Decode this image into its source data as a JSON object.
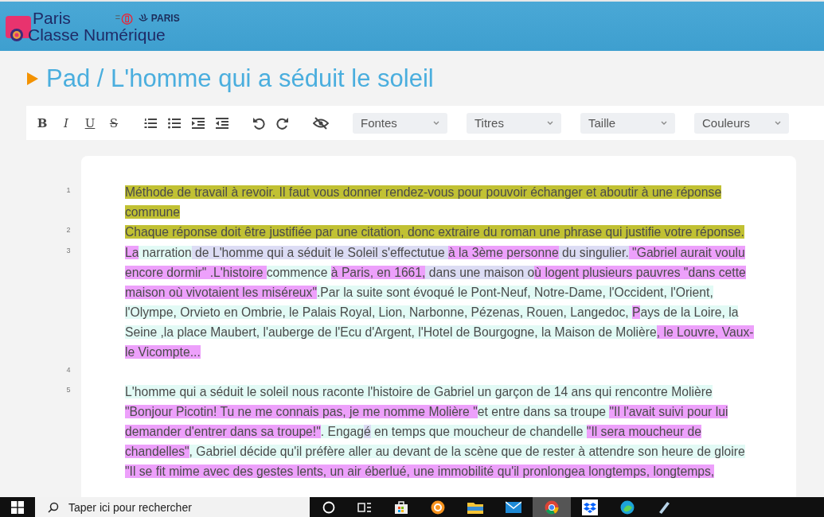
{
  "header": {
    "logo_line1": "Paris",
    "logo_line2": "Classe Numérique",
    "partner": "PARIS"
  },
  "title": "Pad / L'homme qui a séduit le soleil",
  "toolbar": {
    "format_buttons": [
      {
        "label": "B",
        "kind": "bold"
      },
      {
        "label": "I",
        "kind": "italic"
      },
      {
        "label": "U",
        "kind": "underline"
      },
      {
        "label": "S",
        "kind": "strike"
      }
    ],
    "dropdowns": [
      "Fontes",
      "Titres",
      "Taille",
      "Couleurs"
    ]
  },
  "editor": {
    "lines": [
      {
        "number": "1",
        "rows": [
          {
            "segments": [
              {
                "text": "Méthode de travail à revoir. Il faut vous donner rendez-vous pour pouvoir échanger et aboutir à une réponse",
                "color": "#c1c133"
              }
            ]
          },
          {
            "segments": [
              {
                "text": "commune",
                "color": "#c1c133"
              }
            ]
          }
        ]
      },
      {
        "number": "2",
        "rows": [
          {
            "segments": [
              {
                "text": "Chaque réponse doit être justifiée par une citation, donc extraire du roman une phrase qui justifie votre réponse.",
                "color": "#c1c133"
              }
            ]
          }
        ]
      },
      {
        "number": "3",
        "rows": [
          {
            "segments": [
              {
                "text": "La",
                "color": "#eda0fb"
              },
              {
                "text": " narration",
                "color": "#e2faf5"
              },
              {
                "text": " de L'homme qui a séduit le Soleil s'effectutue ",
                "color": "#dcdcf4"
              },
              {
                "text": "à la 3ème personne",
                "color": "#eda0fb"
              },
              {
                "text": " du singulier.",
                "color": "#dcdcf4"
              },
              {
                "text": " \"Gabriel aurait voulu",
                "color": "#eda0fb"
              }
            ]
          },
          {
            "segments": [
              {
                "text": "encore dormir\" .L'histoire ",
                "color": "#eda0fb"
              },
              {
                "text": "commence ",
                "color": "#e2faf5"
              },
              {
                "text": "à Paris, en 1661,",
                "color": "#eda0fb"
              },
              {
                "text": " dans une maison o",
                "color": "#dcdcf4"
              },
              {
                "text": "ù logent plusieurs pauvres \"dans cette",
                "color": "#eda0fb"
              }
            ]
          },
          {
            "segments": [
              {
                "text": "maison où vivotaient les miséreux\"",
                "color": "#eda0fb"
              },
              {
                "text": ".Par la suite sont évoqué le Pont-Neuf, Notre-Dame, l'Occident, l'Orient,",
                "color": "#e2faf5"
              }
            ]
          },
          {
            "segments": [
              {
                "text": "l'Olympe, Orvieto en Ombrie, le Palais Royal, Lion, Narbonne, Pézenas, Rouen, Langedoc, ",
                "color": "#e2faf5"
              },
              {
                "text": "P",
                "color": "#eda0fb"
              },
              {
                "text": "ays de la Loire, la",
                "color": "#e2faf5"
              }
            ]
          },
          {
            "segments": [
              {
                "text": "Seine ,la place Maubert, l'auberge de l'Ecu d'Argent, l'Hotel de Bourgogne, la Maison de Molière",
                "color": "#e2faf5"
              },
              {
                "text": ", le Louvre, Vaux-",
                "color": "#eda0fb"
              }
            ]
          },
          {
            "segments": [
              {
                "text": "le Vicompte...",
                "color": "#eda0fb"
              }
            ]
          }
        ]
      },
      {
        "number": "4"
      },
      {
        "number": "5",
        "rows": [
          {
            "segments": [
              {
                "text": "L'homme qui a séduit le soleil nous raconte l'histoire de Gabriel un garçon de 14 ans qui rencontre Molière",
                "color": "#e2faf5"
              }
            ]
          },
          {
            "segments": [
              {
                "text": "\"Bonjour Picotin! Tu ne me connais pas, je me nomme Molière \"",
                "color": "#eda0fb"
              },
              {
                "text": "et entre dans sa troupe ",
                "color": "#e2faf5"
              },
              {
                "text": "\"Il l'avait suivi pour lui",
                "color": "#eda0fb"
              }
            ]
          },
          {
            "segments": [
              {
                "text": "demander d'entrer dans sa troupe!\"",
                "color": "#eda0fb"
              },
              {
                "text": ". Engag",
                "color": "#e2faf5"
              },
              {
                "text": "é",
                "color": "#dcdcf4"
              },
              {
                "text": " en temps que moucheur de chandelle ",
                "color": "#e2faf5"
              },
              {
                "text": "\"Il sera moucheur de",
                "color": "#eda0fb"
              }
            ]
          },
          {
            "segments": [
              {
                "text": "chandelles\"",
                "color": "#eda0fb"
              },
              {
                "text": ", Gabriel décide qu'il préfère aller au devant de la scène que de rester à attendre son heure de gloire",
                "color": "#e2faf5"
              }
            ]
          },
          {
            "segments": [
              {
                "text": "\"Il se fit mime avec des gestes lents, un air éberlué, une immobilité qu'il pronlongea longtemps, longtemps,",
                "color": "#eda0fb"
              }
            ]
          }
        ]
      }
    ]
  },
  "taskbar": {
    "search_placeholder": "Taper ici pour rechercher"
  }
}
